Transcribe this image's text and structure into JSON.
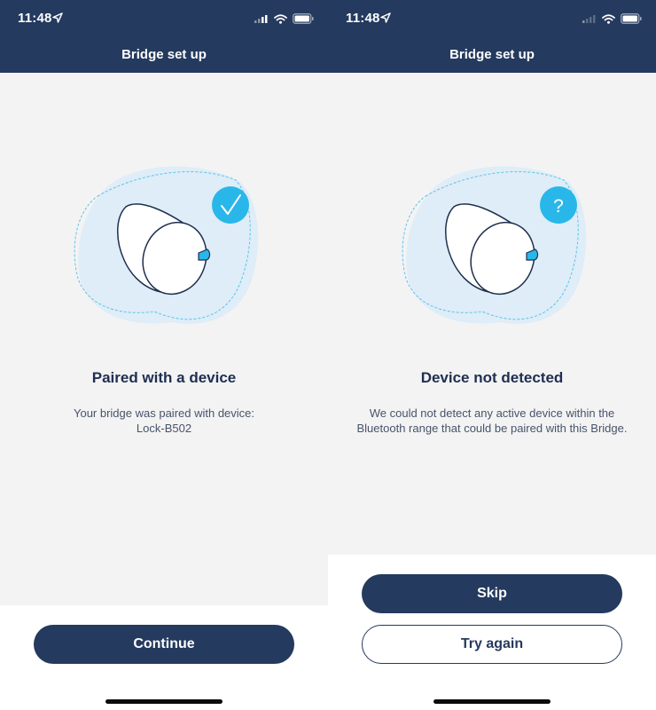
{
  "status_bar": {
    "time": "11:48",
    "icons": [
      "location-arrow-icon",
      "cellular-signal-icon",
      "wifi-icon",
      "battery-icon"
    ]
  },
  "screens": [
    {
      "nav_title": "Bridge set up",
      "badge_icon": "checkmark-icon",
      "heading": "Paired with a device",
      "message_lines": [
        "Your bridge was paired with device:",
        "Lock-B502"
      ],
      "buttons": {
        "continue": "Continue"
      }
    },
    {
      "nav_title": "Bridge set up",
      "badge_icon": "question-mark-icon",
      "badge_text": "?",
      "heading": "Device not detected",
      "message_lines": [
        "We could not detect any active device within the",
        "Bluetooth range that could be paired with this Bridge."
      ],
      "buttons": {
        "skip": "Skip",
        "try_again": "Try again"
      }
    }
  ],
  "colors": {
    "navy": "#243a5e",
    "accent_cyan": "#29b7ea",
    "blob_light": "#deedf7",
    "background": "#f3f3f4"
  }
}
